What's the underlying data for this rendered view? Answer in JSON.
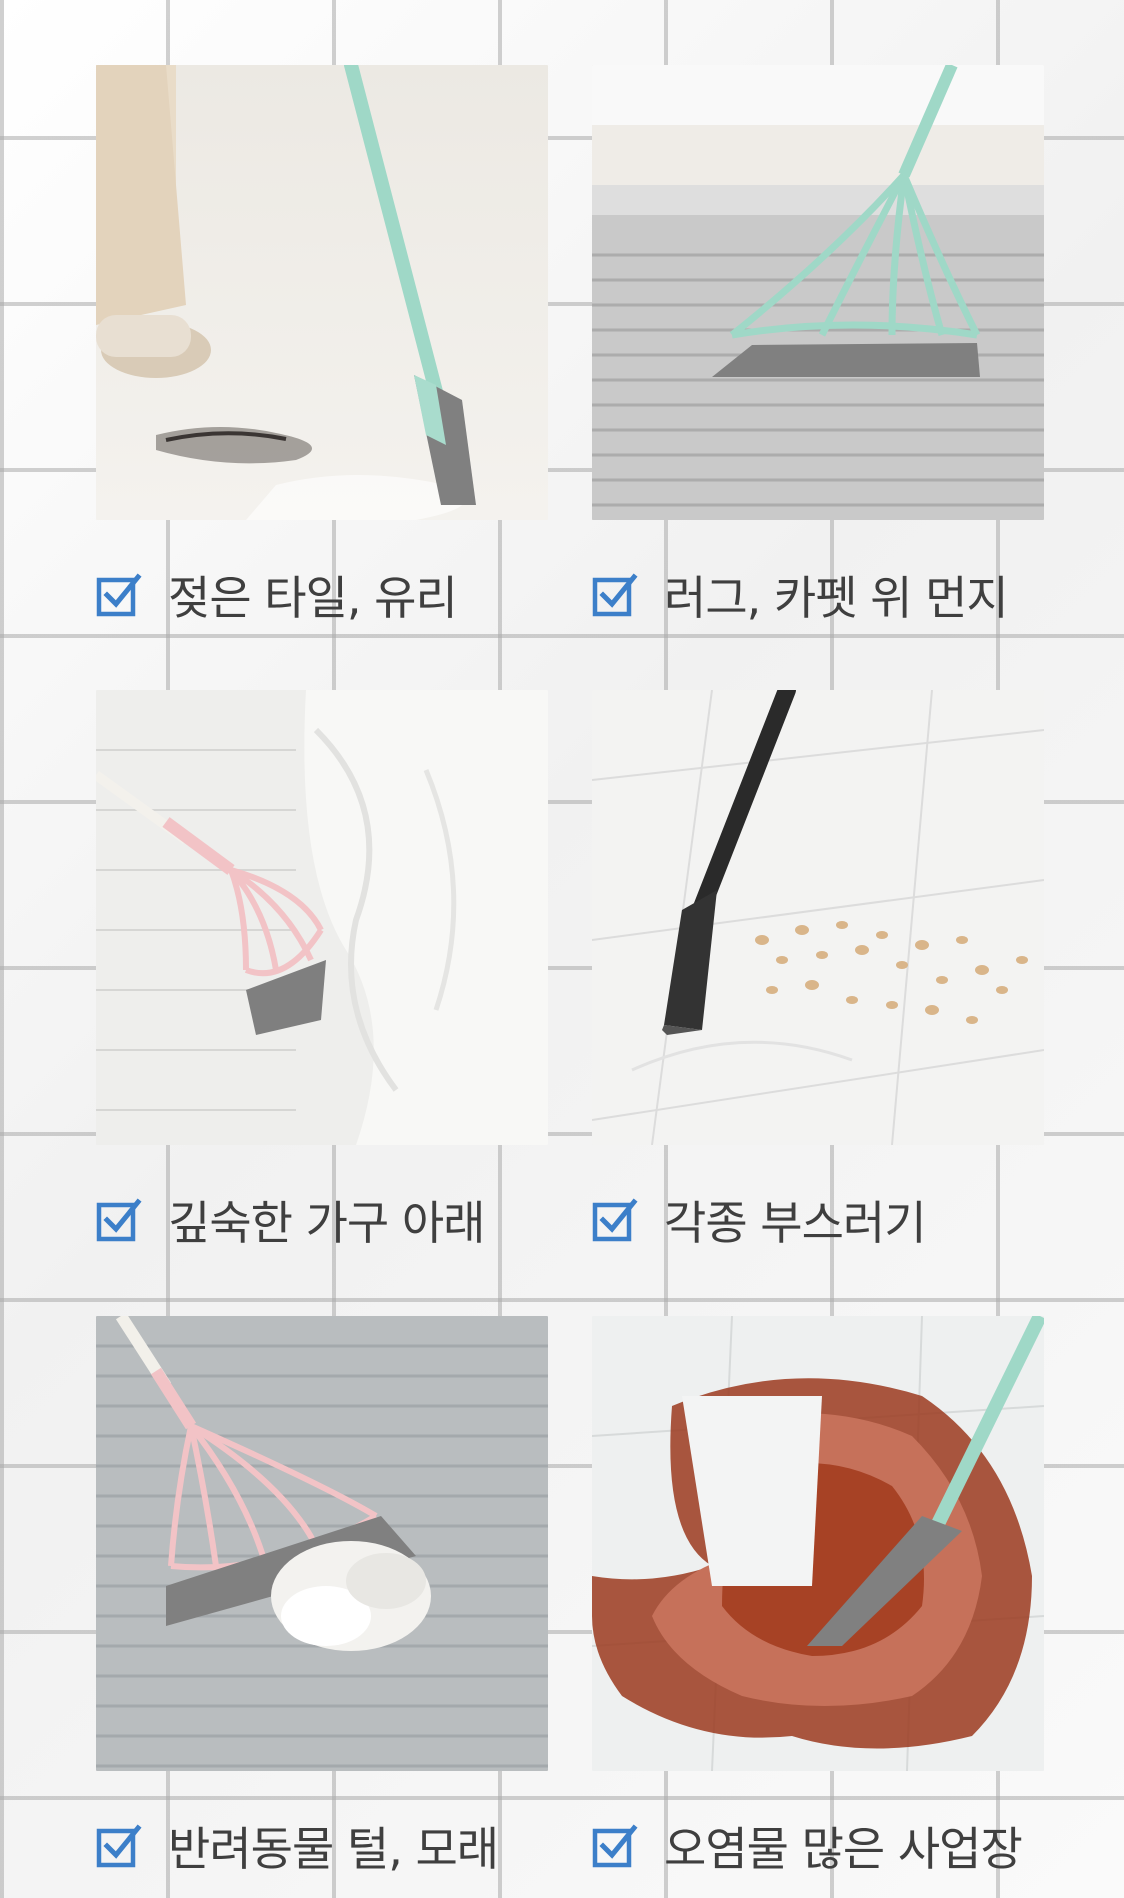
{
  "items": [
    {
      "label": "젖은 타일, 유리",
      "icon": "checkbox-checked-icon",
      "photo": "broom-wet-tile-hair"
    },
    {
      "label": "러그, 카펫 위 먼지",
      "icon": "checkbox-checked-icon",
      "photo": "broom-rug-carpet"
    },
    {
      "label": "깊숙한 가구 아래",
      "icon": "checkbox-checked-icon",
      "photo": "broom-under-bed"
    },
    {
      "label": "각종 부스러기",
      "icon": "checkbox-checked-icon",
      "photo": "broom-shells-on-tile"
    },
    {
      "label": "반려동물 털, 모래",
      "icon": "checkbox-checked-icon",
      "photo": "broom-pet-hair-rug"
    },
    {
      "label": "오염물 많은 사업장",
      "icon": "checkbox-checked-icon",
      "photo": "broom-sauce-spill"
    }
  ],
  "colors": {
    "check": "#3c7fc9",
    "text": "#3f3f3f",
    "mint": "#9fd8c7",
    "pink": "#f2c3c6",
    "black": "#2a2a2a",
    "squeegee": "#7f7f7f"
  }
}
